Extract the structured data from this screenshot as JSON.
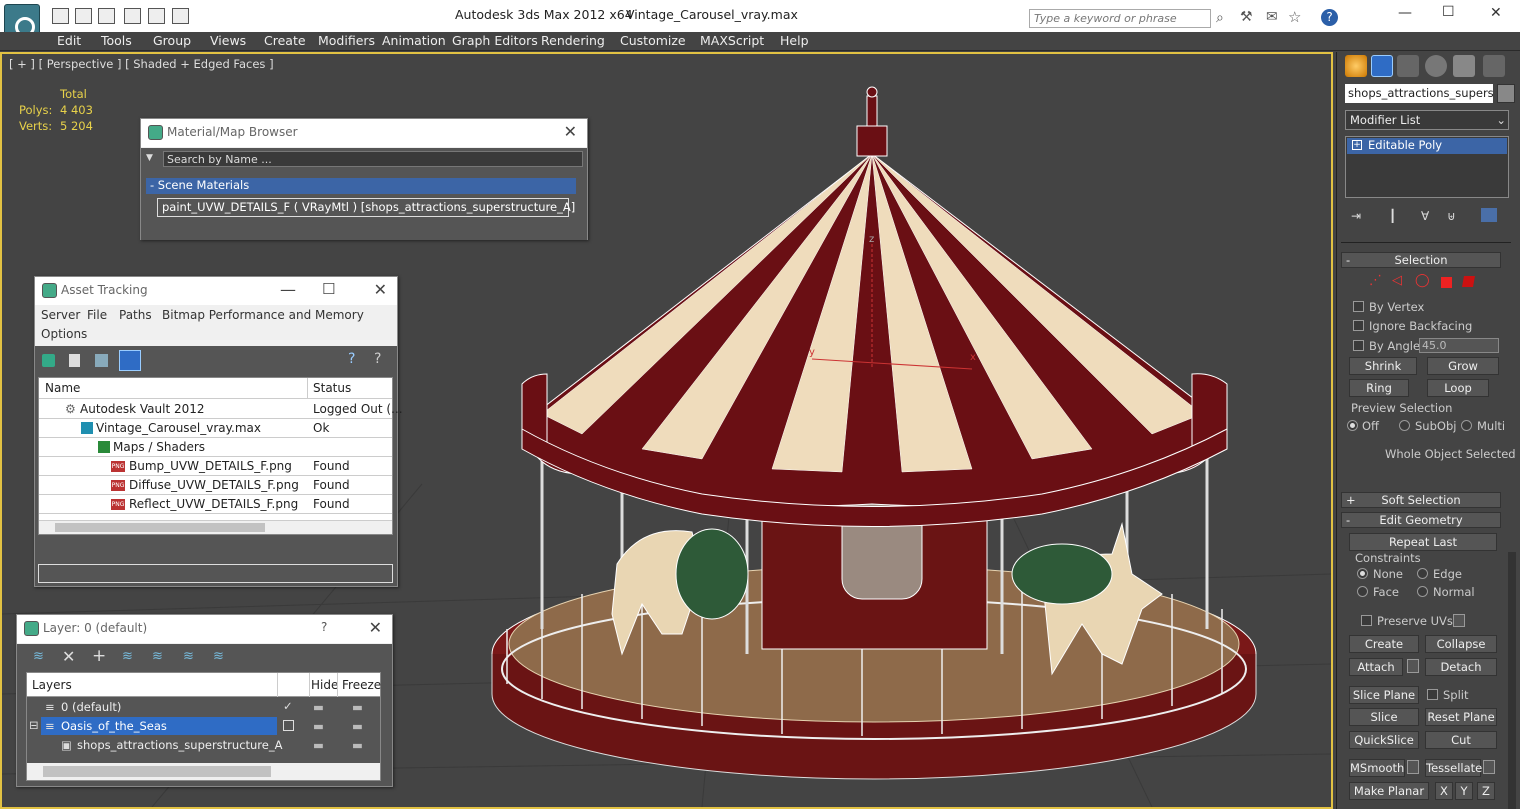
{
  "titlebar": {
    "title": "Autodesk 3ds Max  2012 x64",
    "file": "Vintage_Carousel_vray.max",
    "search_placeholder": "Type a keyword or phrase",
    "minimize": "—",
    "maximize": "☐",
    "close": "✕",
    "help": "?"
  },
  "menu": [
    "Edit",
    "Tools",
    "Group",
    "Views",
    "Create",
    "Modifiers",
    "Animation",
    "Graph Editors",
    "Rendering",
    "Customize",
    "MAXScript",
    "Help"
  ],
  "viewport": {
    "label": "[ + ] [ Perspective ] [ Shaded + Edged Faces ]",
    "stats": {
      "total_label": "Total",
      "polys_label": "Polys:",
      "polys_value": "4 403",
      "verts_label": "Verts:",
      "verts_value": "5 204"
    },
    "axis": {
      "x": "x",
      "y": "y",
      "z": "z"
    }
  },
  "material_browser": {
    "title": "Material/Map Browser",
    "search_placeholder": "Search by Name ...",
    "group": "- Scene Materials",
    "item": "paint_UVW_DETAILS_F ( VRayMtl ) [shops_attractions_superstructure_A]"
  },
  "asset_tracking": {
    "title": "Asset Tracking",
    "menu": [
      "Server",
      "File",
      "Paths",
      "Bitmap Performance and Memory",
      "Options"
    ],
    "columns": [
      "Name",
      "Status"
    ],
    "rows": [
      {
        "name": "Autodesk Vault 2012",
        "status": "Logged Out (..."
      },
      {
        "name": "Vintage_Carousel_vray.max",
        "status": "Ok"
      },
      {
        "name": "Maps / Shaders",
        "status": ""
      },
      {
        "name": "Bump_UVW_DETAILS_F.png",
        "status": "Found"
      },
      {
        "name": "Diffuse_UVW_DETAILS_F.png",
        "status": "Found"
      },
      {
        "name": "Reflect_UVW_DETAILS_F.png",
        "status": "Found"
      }
    ],
    "png_badge": "PNG"
  },
  "layer": {
    "title": "Layer: 0 (default)",
    "help": "?",
    "columns": [
      "Layers",
      "Hide",
      "Freeze"
    ],
    "rows": [
      {
        "name": "0 (default)"
      },
      {
        "name": "Oasis_of_the_Seas"
      },
      {
        "name": "shops_attractions_superstructure_A"
      }
    ]
  },
  "command_panel": {
    "object_name": "shops_attractions_superstruc",
    "modifier_list": "Modifier List",
    "stack_item": "Editable Poly",
    "selection": {
      "header": "Selection",
      "by_vertex": "By Vertex",
      "ignore_backfacing": "Ignore Backfacing",
      "by_angle": "By Angle:",
      "angle_value": "45.0",
      "shrink": "Shrink",
      "grow": "Grow",
      "ring": "Ring",
      "loop": "Loop",
      "preview_selection": "Preview Selection",
      "off": "Off",
      "subobj": "SubObj",
      "multi": "Multi",
      "status": "Whole Object Selected"
    },
    "soft_selection": "Soft Selection",
    "edit_geometry": {
      "header": "Edit Geometry",
      "repeat_last": "Repeat Last",
      "constraints": "Constraints",
      "none": "None",
      "edge": "Edge",
      "face": "Face",
      "normal": "Normal",
      "preserve_uvs": "Preserve UVs",
      "create": "Create",
      "collapse": "Collapse",
      "attach": "Attach",
      "detach": "Detach",
      "slice_plane": "Slice Plane",
      "split": "Split",
      "slice": "Slice",
      "reset_plane": "Reset Plane",
      "quickslice": "QuickSlice",
      "cut": "Cut",
      "msmooth": "MSmooth",
      "tessellate": "Tessellate",
      "make_planar": "Make Planar",
      "x": "X",
      "y": "Y",
      "z": "Z"
    }
  }
}
